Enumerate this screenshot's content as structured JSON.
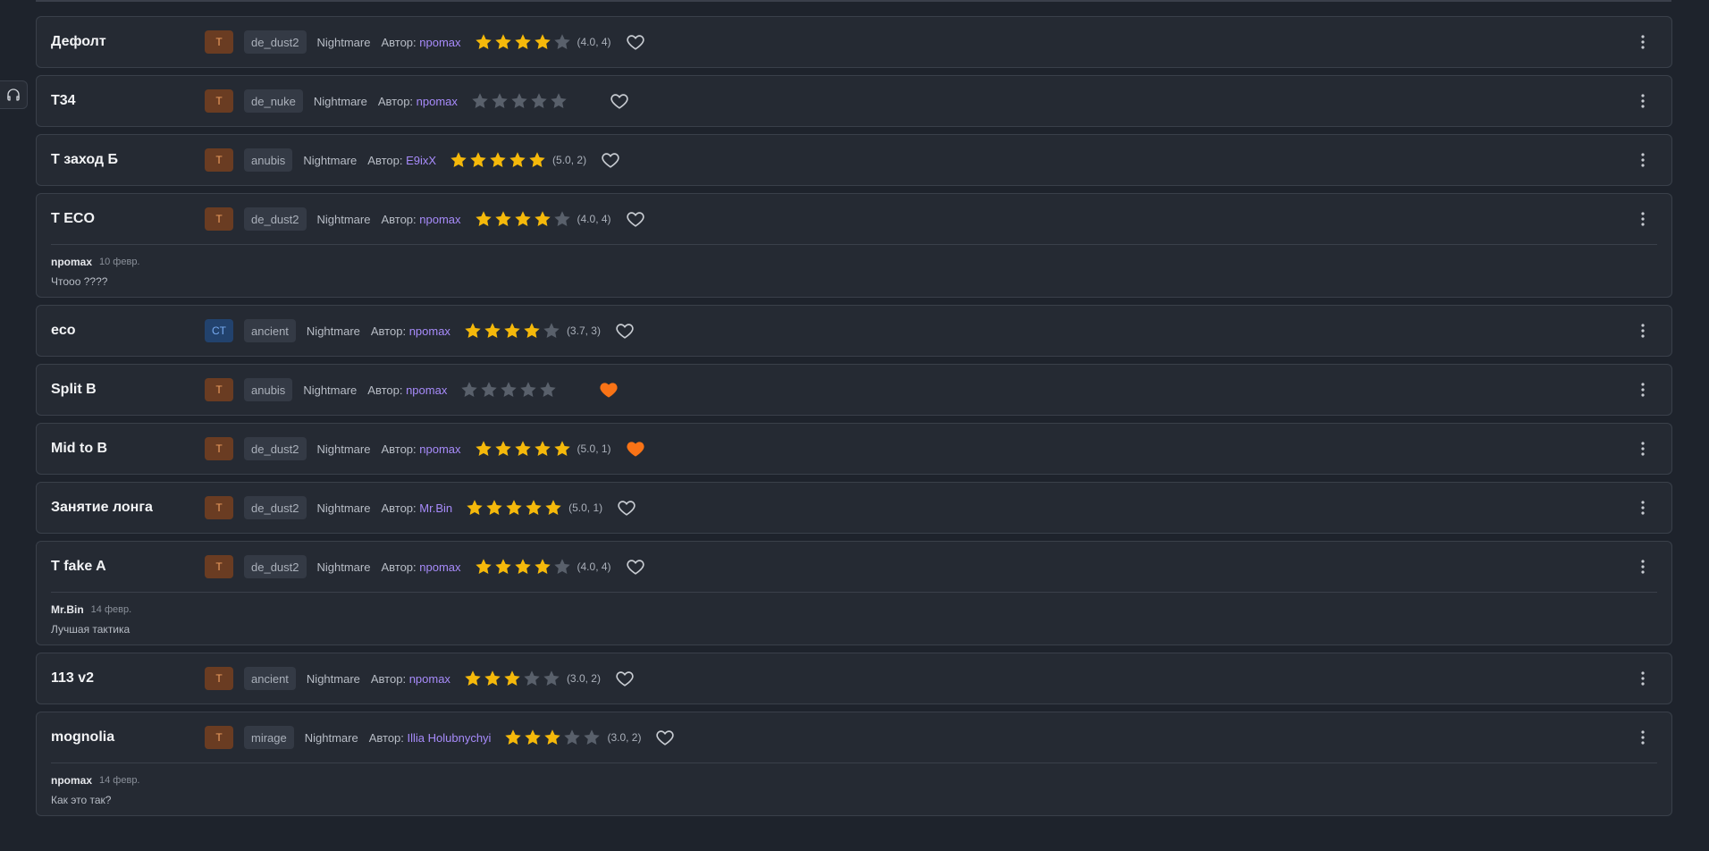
{
  "author_prefix": "Автор:",
  "colors": {
    "star_on": "#f5b90b",
    "star_off": "#59606b",
    "heart_fav": "#f97316",
    "link": "#a78bfa"
  },
  "icons": {
    "side_tab": "headphones-icon",
    "more": "more-vertical-icon",
    "favorite": "heart-icon",
    "rating": "star-icon"
  },
  "tactics": [
    {
      "name": "Дефолт",
      "side": "T",
      "map": "de_dust2",
      "difficulty": "Nightmare",
      "author": "npomax",
      "stars": 4,
      "rating_text": "(4.0, 4)",
      "favorite": false,
      "comment": null
    },
    {
      "name": "T34",
      "side": "T",
      "map": "de_nuke",
      "difficulty": "Nightmare",
      "author": "npomax",
      "stars": 0,
      "rating_text": "",
      "favorite": false,
      "comment": null
    },
    {
      "name": "T заход Б",
      "side": "T",
      "map": "anubis",
      "difficulty": "Nightmare",
      "author": "E9ixX",
      "stars": 5,
      "rating_text": "(5.0, 2)",
      "favorite": false,
      "comment": null
    },
    {
      "name": "T ECO",
      "side": "T",
      "map": "de_dust2",
      "difficulty": "Nightmare",
      "author": "npomax",
      "stars": 4,
      "rating_text": "(4.0, 4)",
      "favorite": false,
      "comment": {
        "user": "npomax",
        "date": "10 февр.",
        "text": "Чтооо ????"
      }
    },
    {
      "name": "eco",
      "side": "CT",
      "map": "ancient",
      "difficulty": "Nightmare",
      "author": "npomax",
      "stars": 4,
      "rating_text": "(3.7, 3)",
      "favorite": false,
      "comment": null
    },
    {
      "name": "Split B",
      "side": "T",
      "map": "anubis",
      "difficulty": "Nightmare",
      "author": "npomax",
      "stars": 0,
      "rating_text": "",
      "favorite": true,
      "comment": null
    },
    {
      "name": "Mid to B",
      "side": "T",
      "map": "de_dust2",
      "difficulty": "Nightmare",
      "author": "npomax",
      "stars": 5,
      "rating_text": "(5.0, 1)",
      "favorite": true,
      "comment": null
    },
    {
      "name": "Занятие лонга",
      "side": "T",
      "map": "de_dust2",
      "difficulty": "Nightmare",
      "author": "Mr.Bin",
      "stars": 5,
      "rating_text": "(5.0, 1)",
      "favorite": false,
      "comment": null
    },
    {
      "name": "T fake A",
      "side": "T",
      "map": "de_dust2",
      "difficulty": "Nightmare",
      "author": "npomax",
      "stars": 4,
      "rating_text": "(4.0, 4)",
      "favorite": false,
      "comment": {
        "user": "Mr.Bin",
        "date": "14 февр.",
        "text": "Лучшая тактика"
      }
    },
    {
      "name": "113 v2",
      "side": "T",
      "map": "ancient",
      "difficulty": "Nightmare",
      "author": "npomax",
      "stars": 3,
      "rating_text": "(3.0, 2)",
      "favorite": false,
      "comment": null
    },
    {
      "name": "mognolia",
      "side": "T",
      "map": "mirage",
      "difficulty": "Nightmare",
      "author": "Illia Holubnychyi",
      "stars": 3,
      "rating_text": "(3.0, 2)",
      "favorite": false,
      "comment": {
        "user": "npomax",
        "date": "14 февр.",
        "text": "Как это так?"
      }
    }
  ]
}
